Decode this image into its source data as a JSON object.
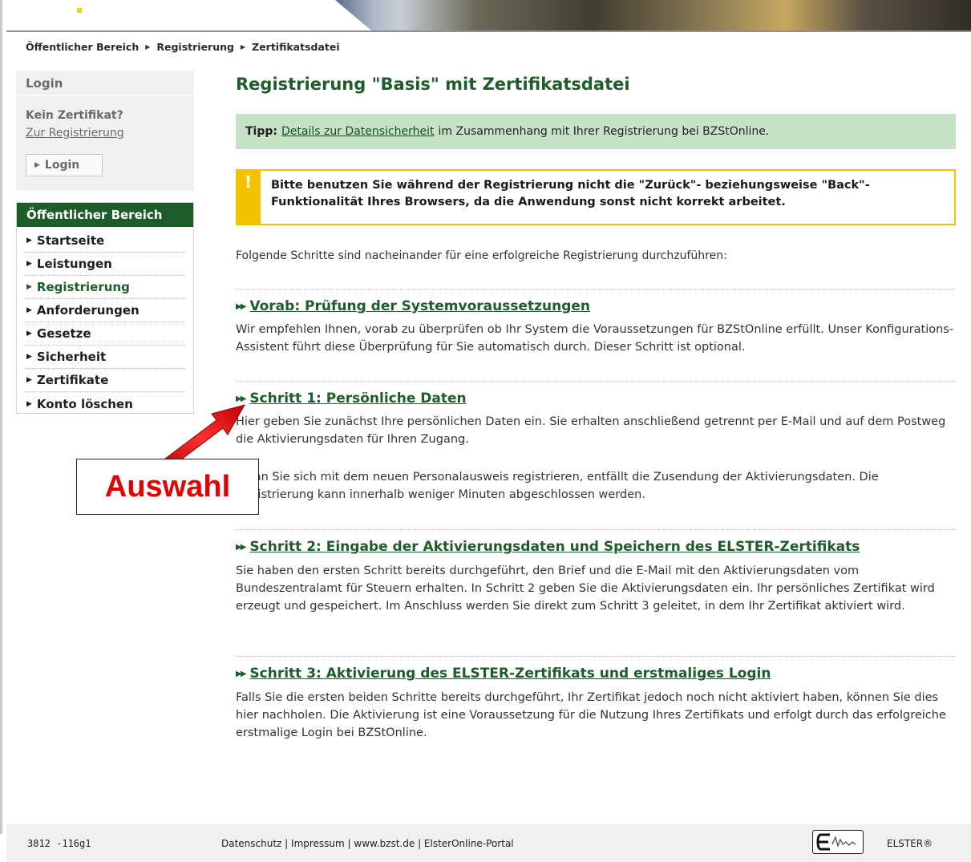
{
  "breadcrumb": [
    "Öffentlicher Bereich",
    "Registrierung",
    "Zertifikatsdatei"
  ],
  "sidebar": {
    "login_title": "Login",
    "no_certificate": "Kein Zertifikat?",
    "register_link": "Zur Registrierung",
    "login_button": "Login",
    "nav_header": "Öffentlicher Bereich",
    "nav_items": [
      "Startseite",
      "Leistungen",
      "Registrierung",
      "Anforderungen",
      "Gesetze",
      "Sicherheit",
      "Zertifikate",
      "Konto löschen"
    ]
  },
  "main": {
    "title": "Registrierung \"Basis\" mit Zertifikatsdatei",
    "tip": {
      "label": "Tipp:",
      "link": "Details zur Datensicherheit",
      "text": "im Zusammenhang mit Ihrer Registrierung bei BZStOnline."
    },
    "warning": {
      "mark": "!",
      "text": "Bitte benutzen Sie während der Registrierung nicht die \"Zurück\"- beziehungsweise \"Back\"-Funktionalität Ihres Browsers, da die Anwendung sonst nicht korrekt arbeitet."
    },
    "intro": "Folgende Schritte sind nacheinander für eine erfolgreiche Registrierung durchzuführen:",
    "steps": [
      {
        "title": "Vorab: Prüfung der Systemvoraussetzungen",
        "paragraphs": [
          "Wir empfehlen Ihnen, vorab zu überprüfen ob Ihr System die Voraussetzungen für BZStOnline erfüllt. Unser Konfigurations-Assistent führt diese Überprüfung für Sie automatisch durch. Dieser Schritt ist optional."
        ]
      },
      {
        "title": "Schritt 1: Persönliche Daten",
        "paragraphs": [
          "Hier geben Sie zunächst Ihre persönlichen Daten ein. Sie erhalten anschließend getrennt per E-Mail und auf dem Postweg die Aktivierungsdaten für Ihren Zugang.",
          "Wenn Sie sich mit dem neuen Personalausweis registrieren, entfällt die Zusendung der Aktivierungsdaten. Die Registrierung kann innerhalb weniger Minuten abgeschlossen werden."
        ]
      },
      {
        "title": "Schritt 2: Eingabe der Aktivierungsdaten und Speichern des ELSTER-Zertifikats",
        "paragraphs": [
          "Sie haben den ersten Schritt bereits durchgeführt, den Brief und die E-Mail mit den Aktivierungsdaten vom Bundeszentralamt für Steuern erhalten. In Schritt 2 geben Sie die Aktivierungsdaten ein. Ihr persönliches Zertifikat wird erzeugt und gespeichert. Im Anschluss werden Sie direkt zum Schritt 3 geleitet, in dem Ihr Zertifikat aktiviert wird."
        ]
      },
      {
        "title": "Schritt 3: Aktivierung des ELSTER-Zertifikats und erstmaliges Login",
        "paragraphs": [
          "Falls Sie die ersten beiden Schritte bereits durchgeführt, Ihr Zertifikat jedoch noch nicht aktiviert haben, können Sie dies hier nachholen. Die Aktivierung ist eine Voraussetzung für die Nutzung Ihres Zertifikats und erfolgt durch das erfolgreiche erstmalige Login bei BZStOnline."
        ]
      }
    ]
  },
  "annotation": {
    "label": "Auswahl",
    "color": "#e00000"
  },
  "footer": {
    "code": "3812 -116g1",
    "links": [
      "Datenschutz",
      "Impressum",
      "www.bzst.de",
      "ElsterOnline-Portal"
    ],
    "separator": " | ",
    "brand": "ELSTER®"
  },
  "colors": {
    "brand_green": "#1f5c2b",
    "tip_background": "#c6e3c8",
    "warning_yellow": "#f3c300"
  }
}
